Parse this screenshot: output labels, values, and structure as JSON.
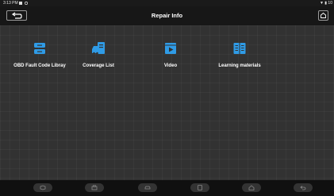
{
  "status_bar": {
    "time": "3:13 PM",
    "right_text": "▼ ▮ 10"
  },
  "header": {
    "title": "Repair Info"
  },
  "tiles": [
    {
      "label": "OBD Fault Code Libray",
      "icon": "database-icon"
    },
    {
      "label": "Coverage List",
      "icon": "car-list-icon"
    },
    {
      "label": "Video",
      "icon": "video-icon"
    },
    {
      "label": "Learning materials",
      "icon": "book-icon"
    }
  ],
  "colors": {
    "accent": "#2f9be6",
    "background": "#323232",
    "header": "#171717",
    "nav_bar": "#101010"
  },
  "nav_bar": {
    "icons": [
      "vci-icon",
      "print-icon",
      "car-icon",
      "screenshot-icon",
      "home-icon",
      "back-icon"
    ]
  }
}
